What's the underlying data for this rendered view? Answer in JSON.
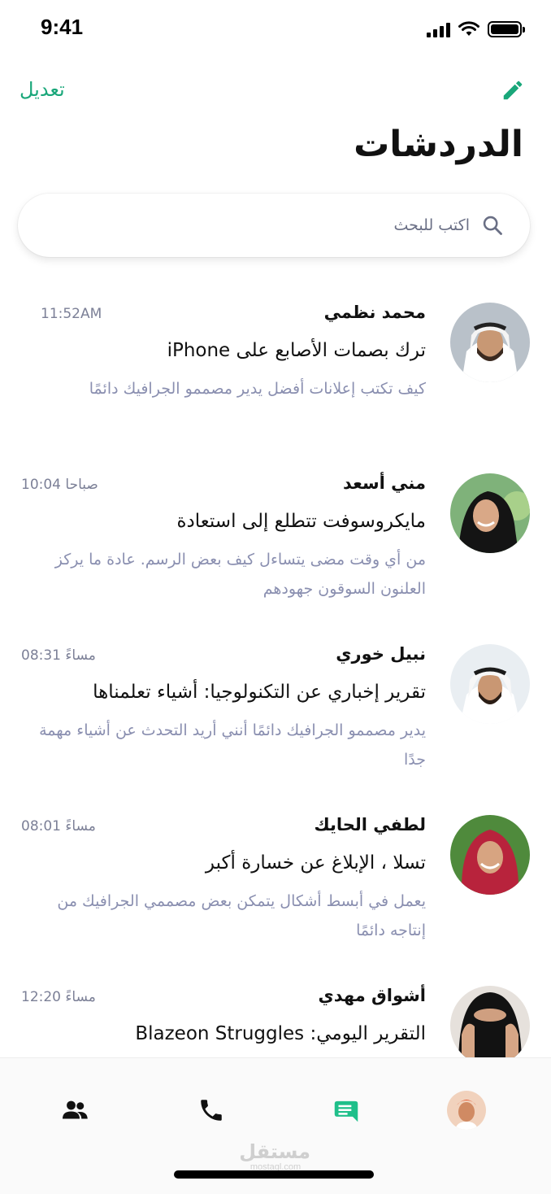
{
  "status_bar": {
    "time": "9:41"
  },
  "header": {
    "edit_label": "تعديل",
    "title": "الدردشات",
    "accent_color": "#1aa77a"
  },
  "search": {
    "placeholder": "اكتب للبحث"
  },
  "chats": [
    {
      "name": "محمد نظمي",
      "time": "11:52AM",
      "subject": "ترك بصمات الأصابع على iPhone",
      "preview": "كيف تكتب إعلانات أفضل يدير مصممو الجرافيك دائمًا"
    },
    {
      "name": "مني أسعد",
      "time": "10:04 صباحا",
      "subject": "مايكروسوفت تتطلع إلى استعادة",
      "preview": "من أي وقت مضى يتساءل كيف بعض الرسم. عادة ما يركز العلنون السوقون جهودهم"
    },
    {
      "name": "نبيل خوري",
      "time": "08:31 مساءً",
      "subject": "تقرير إخباري عن التكنولوجيا: أشياء تعلمناها",
      "preview": "يدير مصممو الجرافيك دائمًا أنني أريد التحدث عن أشياء مهمة جدًا"
    },
    {
      "name": "لطفي الحايك",
      "time": "08:01 مساءً",
      "subject": "تسلا ، الإبلاغ عن خسارة أكبر",
      "preview": "يعمل في أبسط أشكال يتمكن بعض مصممي الجرافيك من إنتاجه دائمًا"
    },
    {
      "name": "أشواق مهدي",
      "time": "12:20 مساءً",
      "subject": "التقرير اليومي: Blazeon Struggles",
      "preview": ""
    }
  ],
  "tab_bar": {
    "tabs": [
      "contacts-icon",
      "phone-icon",
      "chat-icon",
      "profile-avatar"
    ],
    "active": "chat-icon",
    "watermark_ar": "مستقل",
    "watermark_en": "mostaql.com"
  }
}
